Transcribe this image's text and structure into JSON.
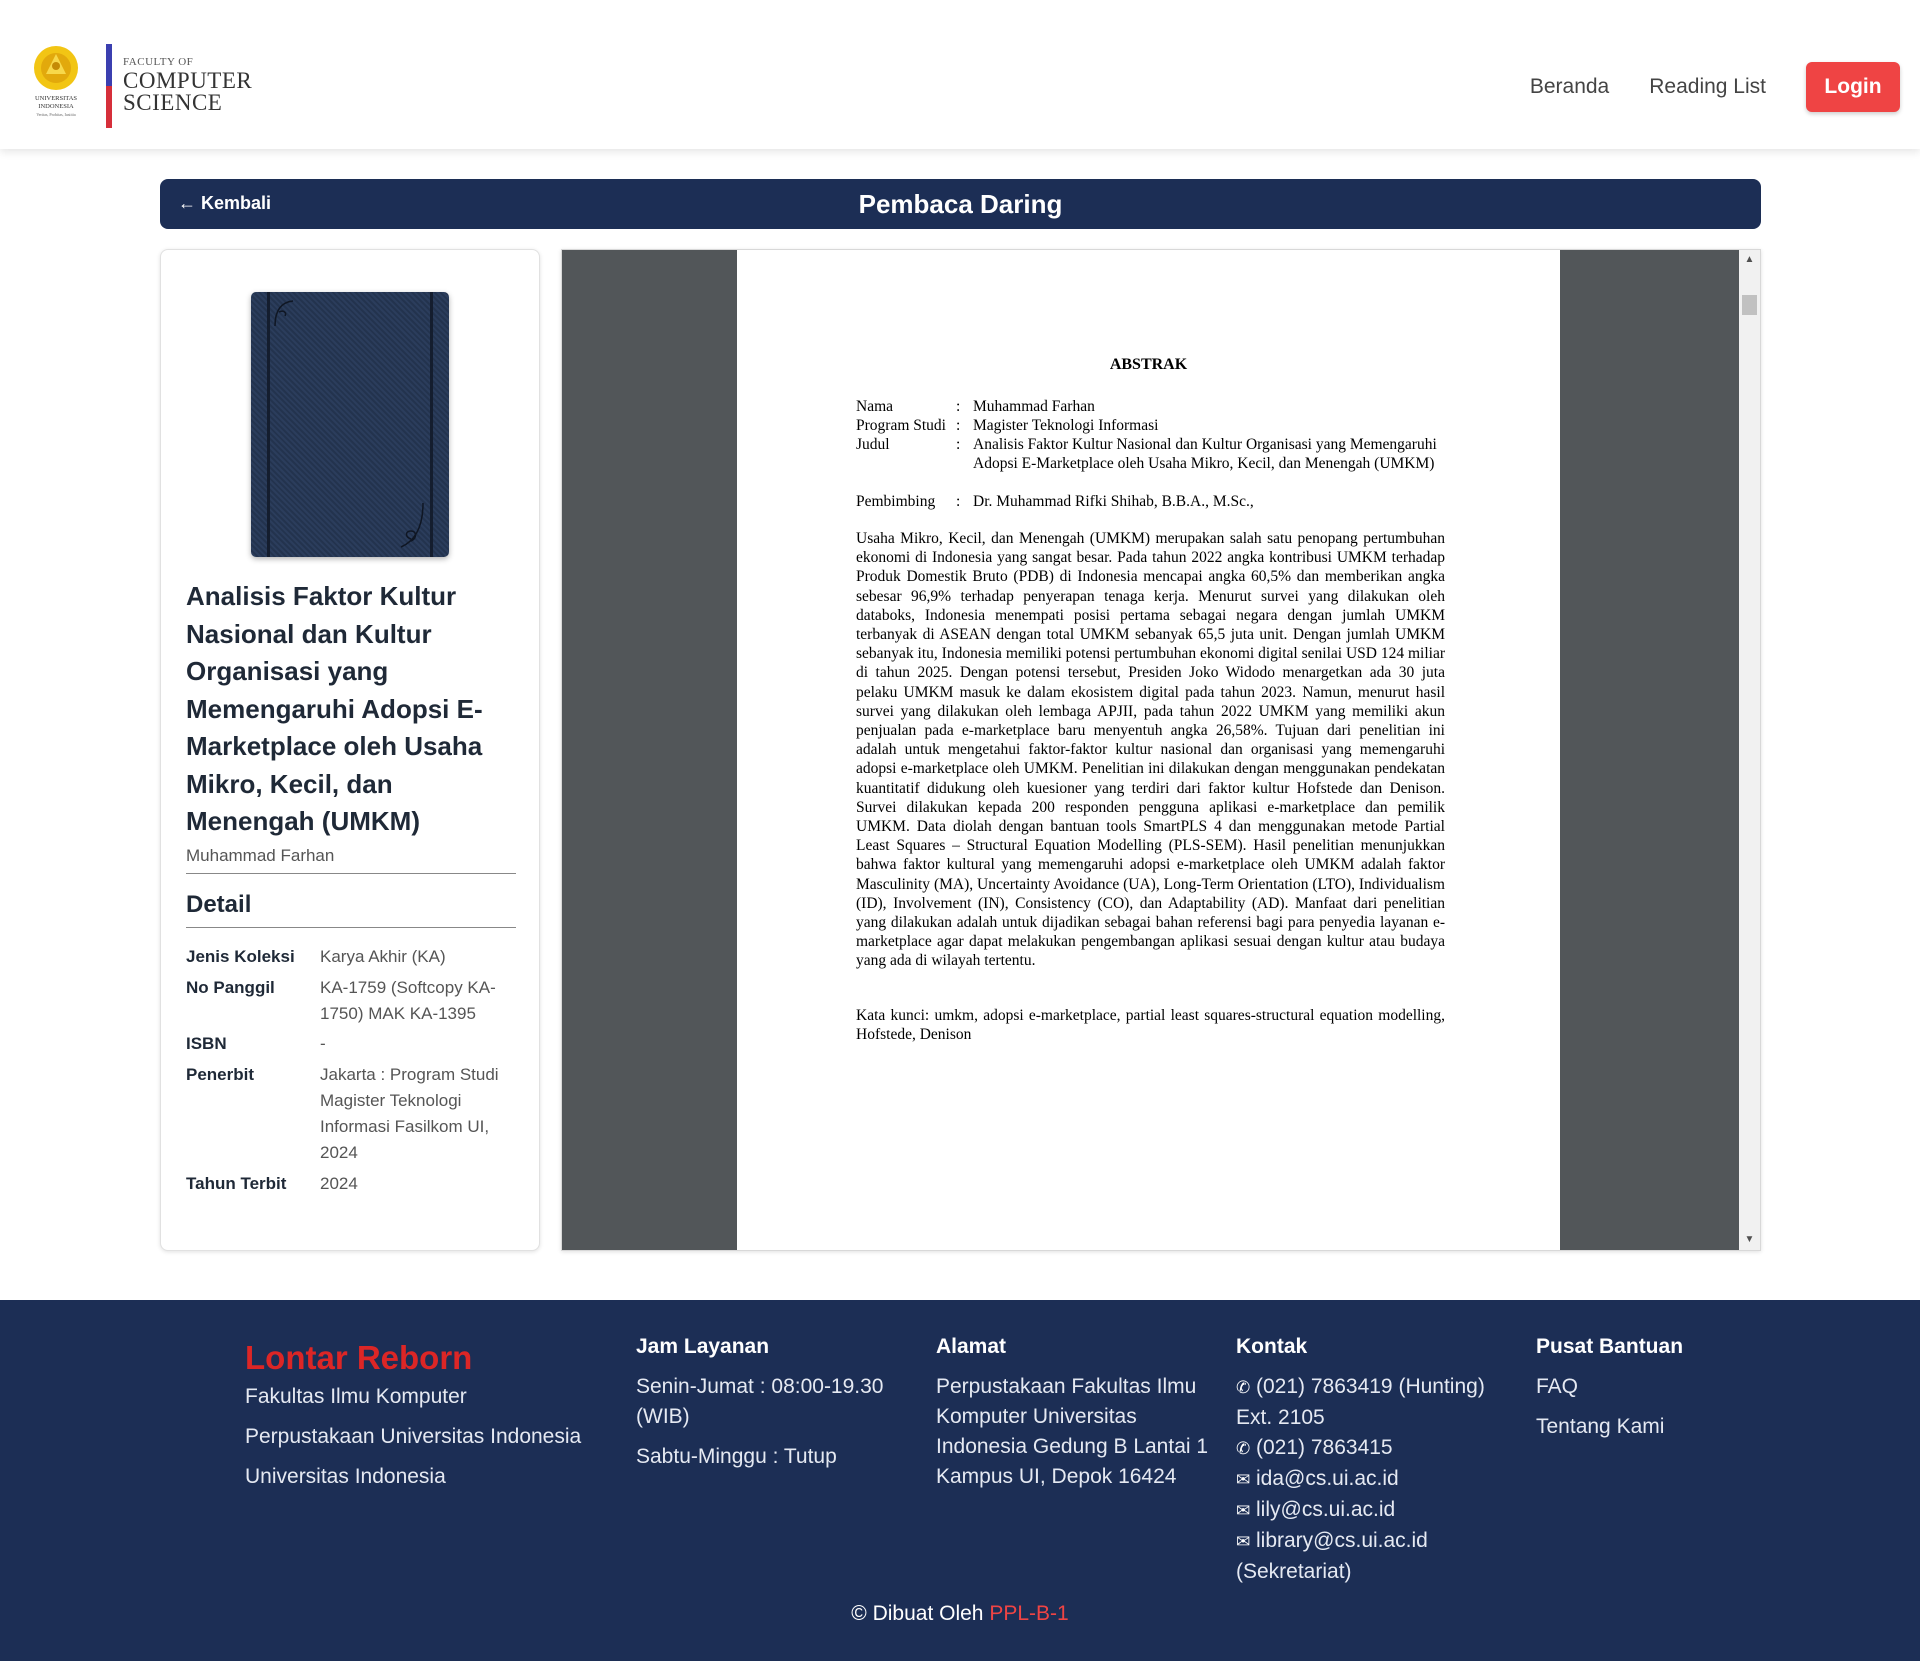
{
  "header": {
    "logo": {
      "seal_text": [
        "UNIVERSITAS",
        "INDONESIA",
        "Veritas, Probitas, Iustitia"
      ],
      "faculty_small": "FACULTY OF",
      "faculty_line1": "COMPUTER",
      "faculty_line2": "SCIENCE"
    },
    "nav": {
      "home": "Beranda",
      "reading_list": "Reading List",
      "login": "Login"
    },
    "colors": {
      "login_button": "#ef4444",
      "navy": "#1c2e55"
    }
  },
  "titlebar": {
    "back_label": "← Kembali",
    "title": "Pembaca Daring"
  },
  "book": {
    "title": "Analisis Faktor Kultur Nasional dan Kultur Organisasi yang Memengaruhi Adopsi E-Marketplace oleh Usaha Mikro, Kecil, dan Menengah (UMKM)",
    "author": "Muhammad Farhan",
    "detail_heading": "Detail",
    "details": [
      {
        "label": "Jenis Koleksi",
        "value": "Karya Akhir (KA)"
      },
      {
        "label": "No Panggil",
        "value": "KA-1759 (Softcopy KA-1750) MAK KA-1395"
      },
      {
        "label": "ISBN",
        "value": "-"
      },
      {
        "label": "Penerbit",
        "value": "Jakarta : Program Studi Magister Teknologi Informasi Fasilkom UI, 2024"
      },
      {
        "label": "Tahun Terbit",
        "value": "2024"
      }
    ]
  },
  "pdf": {
    "heading": "ABSTRAK",
    "meta": [
      {
        "key": "Nama",
        "value": "Muhammad Farhan"
      },
      {
        "key": "Program Studi",
        "value": "Magister Teknologi Informasi"
      },
      {
        "key": "Judul",
        "value": "Analisis Faktor Kultur Nasional dan Kultur Organisasi yang Memengaruhi Adopsi E-Marketplace oleh Usaha Mikro, Kecil, dan Menengah (UMKM)"
      },
      {
        "key": "Pembimbing",
        "value": "Dr. Muhammad Rifki Shihab, B.B.A., M.Sc.,"
      }
    ],
    "body": "Usaha Mikro, Kecil, dan Menengah (UMKM) merupakan salah satu penopang pertumbuhan ekonomi di Indonesia yang sangat besar. Pada tahun 2022 angka kontribusi UMKM terhadap Produk Domestik Bruto (PDB) di Indonesia mencapai angka 60,5% dan memberikan angka sebesar 96,9% terhadap penyerapan tenaga kerja. Menurut survei yang dilakukan oleh databoks, Indonesia menempati posisi pertama sebagai negara dengan jumlah UMKM terbanyak di ASEAN dengan total UMKM sebanyak 65,5 juta unit. Dengan jumlah UMKM sebanyak itu, Indonesia memiliki potensi pertumbuhan ekonomi digital senilai USD 124 miliar di tahun 2025. Dengan potensi tersebut, Presiden Joko Widodo menargetkan ada 30 juta pelaku UMKM masuk ke dalam ekosistem digital pada tahun 2023. Namun, menurut hasil survei yang dilakukan oleh lembaga APJII, pada tahun 2022 UMKM yang memiliki akun penjualan pada e-marketplace baru menyentuh angka 26,58%. Tujuan dari penelitian ini adalah untuk mengetahui faktor-faktor kultur nasional dan organisasi yang memengaruhi adopsi e-marketplace oleh UMKM. Penelitian ini dilakukan dengan menggunakan pendekatan kuantitatif didukung oleh kuesioner yang terdiri dari faktor kultur Hofstede dan Denison. Survei dilakukan kepada 200 responden pengguna aplikasi e-marketplace dan pemilik UMKM. Data diolah dengan bantuan tools SmartPLS 4 dan menggunakan metode Partial Least Squares – Structural Equation Modelling (PLS-SEM). Hasil penelitian menunjukkan bahwa faktor kultural yang memengaruhi adopsi e-marketplace oleh UMKM adalah faktor Masculinity (MA), Uncertainty Avoidance (UA), Long-Term Orientation (LTO), Individualism (ID), Involvement (IN), Consistency (CO), dan Adaptability (AD). Manfaat dari penelitian yang dilakukan adalah untuk dijadikan sebagai bahan referensi bagi para penyedia layanan e-marketplace agar dapat melakukan pengembangan aplikasi sesuai dengan kultur atau budaya yang ada di wilayah tertentu.",
    "keywords": "Kata kunci: umkm, adopsi e-marketplace, partial least squares-structural equation modelling, Hofstede, Denison"
  },
  "footer": {
    "brand": "Lontar Reborn",
    "brand_links": [
      "Fakultas Ilmu Komputer",
      "Perpustakaan Universitas Indonesia",
      "Universitas Indonesia"
    ],
    "hours": {
      "heading": "Jam Layanan",
      "weekday": "Senin-Jumat : 08:00-19.30 (WIB)",
      "weekend": "Sabtu-Minggu : Tutup"
    },
    "address": {
      "heading": "Alamat",
      "text": "Perpustakaan Fakultas Ilmu Komputer Universitas Indonesia Gedung B Lantai 1 Kampus UI, Depok 16424"
    },
    "contact": {
      "heading": "Kontak",
      "phone1": "(021) 7863419 (Hunting) Ext. 2105",
      "phone2": "(021) 7863415",
      "email1": "ida@cs.ui.ac.id",
      "email2": "lily@cs.ui.ac.id",
      "email3": "library@cs.ui.ac.id (Sekretariat)"
    },
    "help": {
      "heading": "Pusat Bantuan",
      "faq": "FAQ",
      "about": "Tentang Kami"
    },
    "copyright_prefix": "© Dibuat Oleh ",
    "copyright_team": "PPL-B-1"
  }
}
